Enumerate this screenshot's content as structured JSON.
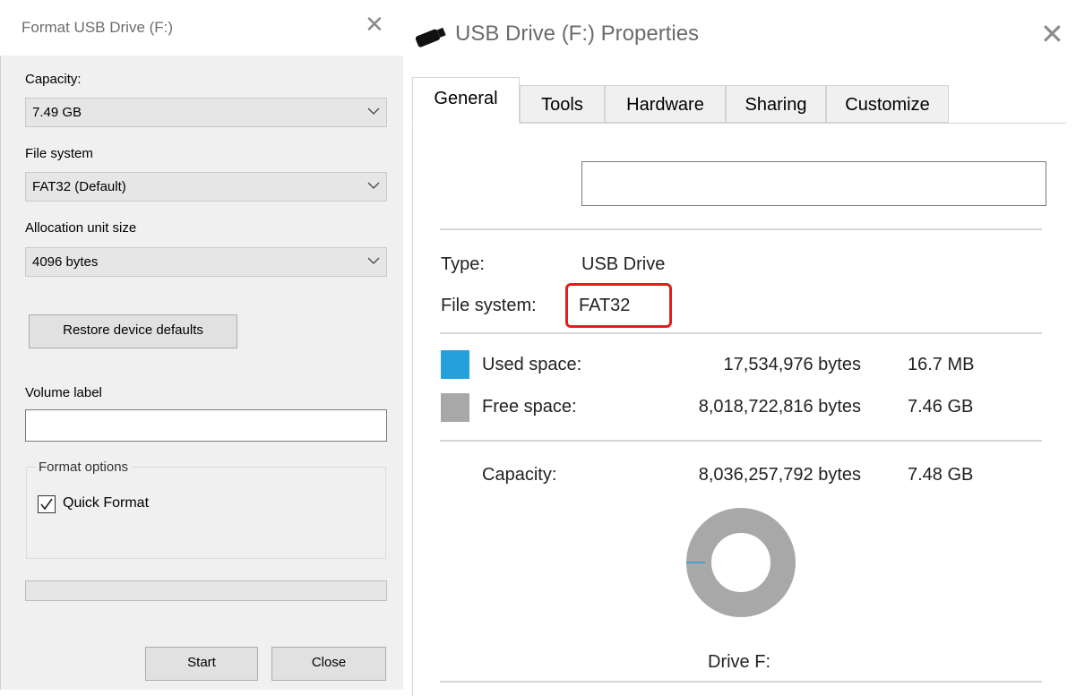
{
  "format_dialog": {
    "title": "Format USB Drive (F:)",
    "close_glyph": "✕",
    "capacity_label": "Capacity:",
    "capacity_value": "7.49 GB",
    "file_system_label": "File system",
    "file_system_value": "FAT32 (Default)",
    "allocation_label": "Allocation unit size",
    "allocation_value": "4096 bytes",
    "restore_button": "Restore device defaults",
    "volume_label": "Volume label",
    "volume_value": "",
    "format_options_label": "Format options",
    "quick_format_label": "Quick Format",
    "quick_format_checked": true,
    "progress": 0,
    "start_button": "Start",
    "close_button": "Close"
  },
  "properties_dialog": {
    "title": "USB Drive (F:) Properties",
    "close_glyph": "✕",
    "tabs": [
      {
        "label": "General",
        "active": true
      },
      {
        "label": "Tools",
        "active": false
      },
      {
        "label": "Hardware",
        "active": false
      },
      {
        "label": "Sharing",
        "active": false
      },
      {
        "label": "Customize",
        "active": false
      }
    ],
    "drive_name_value": "",
    "type_label": "Type:",
    "type_value": "USB Drive",
    "file_system_label": "File system:",
    "file_system_value": "FAT32",
    "used_space_label": "Used space:",
    "used_space_bytes": "17,534,976 bytes",
    "used_space_human": "16.7 MB",
    "free_space_label": "Free space:",
    "free_space_bytes": "8,018,722,816 bytes",
    "free_space_human": "7.46 GB",
    "capacity_label": "Capacity:",
    "capacity_bytes": "8,036,257,792 bytes",
    "capacity_human": "7.48 GB",
    "drive_caption": "Drive F:",
    "colors": {
      "used": "#26a0da",
      "free": "#a8a8a8",
      "highlight": "#e31d1d"
    }
  }
}
